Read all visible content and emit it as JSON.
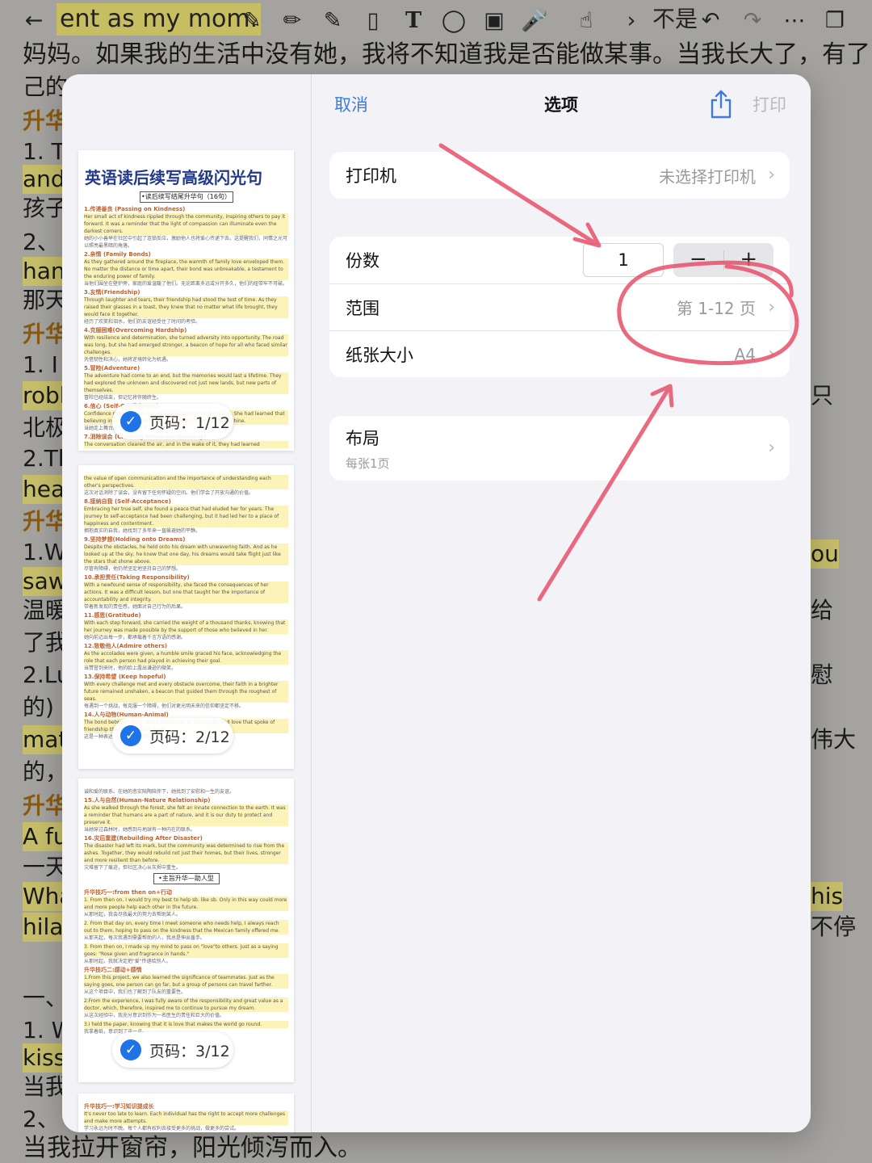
{
  "toolbar": {
    "title": "ent as my mom.",
    "lang_indicator": "不是"
  },
  "background": {
    "line1": "妈妈。如果我的生活中没有她，我将不知道我是否能做某事。当我长大了，有了自",
    "left": [
      "己的",
      "升华",
      "1. T",
      "and",
      "孩子",
      "2、",
      "han",
      "那天",
      "升华",
      "1. I",
      "robb",
      "北极",
      "2.Th",
      "hear",
      "升华",
      "1.W",
      "saw",
      "温暖",
      "了我",
      "2.Lu",
      "的) p",
      "mat",
      "的，",
      "升华",
      "A fu",
      "一天",
      "Wha",
      "hilar",
      "一、",
      "1. W",
      "kiss",
      "当我",
      "2、"
    ],
    "right": [
      "只",
      "ou",
      "给",
      "慰",
      "伟大",
      "his",
      "不停"
    ],
    "bottom": "当我拉开窗帘，阳光倾泻而入。"
  },
  "preview": {
    "page1_title": "英语读后续写高级闪光句",
    "page1_sub": "•读后续写结尾升华句（16句）",
    "page1_blocks": [
      {
        "head": "1.传递善良 (Passing on Kindness)",
        "en": "Her small act of kindness rippled through the community, inspiring others to pay it forward. It was a reminder that the light of compassion can illuminate even the darkest corners.",
        "cn": "她的小小善举在社区中引起了连锁反应，激励他人也将爱心传递下去。这提醒我们，同情之光可以照亮最黑暗的角落。"
      },
      {
        "head": "2.亲情 (Family Bonds)",
        "en": "As they gathered around the fireplace, the warmth of family love enveloped them. No matter the distance or time apart, their bond was unbreakable, a testament to the enduring power of family.",
        "cn": "当他们围坐在壁炉旁，家庭的爱温暖了他们。无论距离多远或分开多久，他们的纽带牢不可破。"
      },
      {
        "head": "3.友情(Friendship)",
        "en": "Through laughter and tears, their friendship had stood the test of time. As they raised their glasses in a toast, they knew that no matter what life brought, they would face it together.",
        "cn": "经历了欢笑和泪水，他们的友谊经受住了时间的考验。"
      },
      {
        "head": "4.克服困难(Overcoming Hardship)",
        "en": "With resilience and determination, she turned adversity into opportunity. The road was long, but she had emerged stronger, a beacon of hope for all who faced similar challenges.",
        "cn": "凭借韧性和决心，她将逆境转化为机遇。"
      },
      {
        "head": "5.冒险(Adventure)",
        "en": "The adventure had come to an end, but the memories would last a lifetime. They had explored the unknown and discovered not just new lands, but new parts of themselves.",
        "cn": "冒险已经结束，但记忆将伴随终生。"
      },
      {
        "head": "6.信心 (Self-Confidence)",
        "en": "Confidence radiated from her as she stepped onto the stage. She had learned that believing in oneself was the first step, and she was ready to shine.",
        "cn": "当她走上舞台时，自信从她身上散发出来。"
      },
      {
        "head": "7.消除误会 (Clearing Misunderstanding)",
        "en": "The conversation cleared the air, and in the wake of it, they had learned",
        "cn": ""
      }
    ],
    "page2_blocks": [
      {
        "head": "",
        "en": "the value of open communication and the importance of understanding each other's perspectives.",
        "cn": "这次对话消除了误会，没有留下任何怀疑的空间。他们学会了开放沟通的价值。"
      },
      {
        "head": "8.接纳自我 (Self-Acceptance)",
        "en": "Embracing her true self, she found a peace that had eluded her for years. The journey to self-acceptance had been challenging, but it had led her to a place of happiness and contentment.",
        "cn": "拥抱真实的自我，她找到了多年来一直躲避她的平静。"
      },
      {
        "head": "9.坚持梦想(Holding onto Dreams)",
        "en": "Despite the obstacles, he held onto his dream with unwavering faith. And as he looked up at the sky, he knew that one day, his dreams would take flight just like the stars that shone above.",
        "cn": "尽管有障碍，他仍然坚定地坚持自己的梦想。"
      },
      {
        "head": "10.承担责任(Taking Responsibility)",
        "en": "With a newfound sense of responsibility, she faced the consequences of her actions. It was a difficult lesson, but one that taught her the importance of accountability and integrity.",
        "cn": "带着新发现的责任感，她面对自己行为的后果。"
      },
      {
        "head": "11.感恩(Gratitude)",
        "en": "With each step forward, she carried the weight of a thousand thanks, knowing that her journey was made possible by the support of those who believed in her.",
        "cn": "她向前迈出每一步，都承载着千言万语的感谢。"
      },
      {
        "head": "12.致敬他人(Admire others)",
        "en": "As the accolades were given, a humble smile graced his face, acknowledging the role that each person had played in achieving their goal.",
        "cn": "当赞誉到来时，他的脸上露出谦逊的微笑。"
      },
      {
        "head": "13.保持希望 (Keep hopeful)",
        "en": "With every challenge met and every obstacle overcome, their faith in a brighter future remained unshaken, a beacon that guided them through the roughest of seas.",
        "cn": "每遇到一个挑战，每克服一个障碍，他们对更光明未来的信仰都坚定不移。"
      },
      {
        "head": "14.人与动物(Human-Animal)",
        "en": "The bond between them was a testament to the loyalty and love that spoke of friendship that was beyond words.",
        "cn": "这是一种表达了忠诚和爱的纽带。"
      }
    ],
    "page3_blocks": [
      {
        "head": "",
        "en": "",
        "cn": "诚和爱的联系。在她的悲实陪陶陪伴下，她找到了安慰和一生的友谊。"
      },
      {
        "head": "15.人与自然(Human-Nature Relationship)",
        "en": "As she walked through the forest, she felt an innate connection to the earth. It was a reminder that humans are a part of nature, and it is our duty to protect and preserve it.",
        "cn": "当她穿过森林时，她感到与地球有一种内在的联系。"
      },
      {
        "head": "16.灾后重建(Rebuilding After Disaster)",
        "en": "The disaster had left its mark, but the community was determined to rise from the ashes. Together, they would rebuild not just their homes, but their lives, stronger and more resilient than before.",
        "cn": "灾难留下了痕迹，但社区决心从灰烬中重生。"
      }
    ],
    "page3_box": "•主旨升华—助人型",
    "page3_blocks2": [
      {
        "head": "升华技巧一:from then on+行动",
        "en": "1. From then on, I would try my best to help sb. like sb. Only in this way could more and more people help each other in the future.",
        "cn": "从那时起，我会尽我最大的努力去帮助某人。"
      },
      {
        "head": "",
        "en": "2. From that day on, every time I meet someone who needs help, I always reach out to them, hoping to pass on the kindness that the Mexican family offered me.",
        "cn": "从那天起，每次我遇到需要帮助的人，我总是伸出援手。"
      },
      {
        "head": "",
        "en": "3. From then on, I made up my mind to pass on \"love\"to others. Just as a saying goes: \"Rose given and fragrance in hands.\"",
        "cn": "从那时起，我就决定把\"爱\"传递给别人。"
      },
      {
        "head": "升华技巧二:感动+感情",
        "en": "1.From this project, we also learned the significance of teammates. Just as the saying goes, one person can go far, but a group of persons can travel farther.",
        "cn": "从这个项目中，我们也了解到了队友的重要性。"
      },
      {
        "head": "",
        "en": "2.From the experience, I was fully aware of the responsibility and great value as a doctor, which, therefore, inspired me to continue to pursue my dream.",
        "cn": "从这次经验中，我充分意识到作为一名医生的责任和巨大的价值。"
      },
      {
        "head": "",
        "en": "3.I held the paper, knowing that it is love that makes the world go round.",
        "cn": "我拿着纸，意识到了这一点。"
      }
    ],
    "page4_blocks": [
      {
        "head": "升华技巧一:学习知识提成长",
        "en": "It's never too late to learn. Each individual has the right to accept more challenges and make more attempts.",
        "cn": "学习永远为时不晚。每个人都有权利去接受更多的挑战，做更多的尝试。"
      }
    ],
    "page_labels": [
      "页码：1/12",
      "页码：2/12",
      "页码：3/12"
    ]
  },
  "options": {
    "cancel": "取消",
    "title": "选项",
    "print": "打印",
    "printer_label": "打印机",
    "printer_value": "未选择打印机",
    "copies_label": "份数",
    "copies_value": "1",
    "range_label": "范围",
    "range_value": "第 1-12 页",
    "paper_label": "纸张大小",
    "paper_value": "A4",
    "layout_label": "布局",
    "layout_value": "每张1页"
  },
  "colors": {
    "accent": "#3d7be0",
    "annotation": "#e8506a",
    "check": "#1f73e8"
  }
}
